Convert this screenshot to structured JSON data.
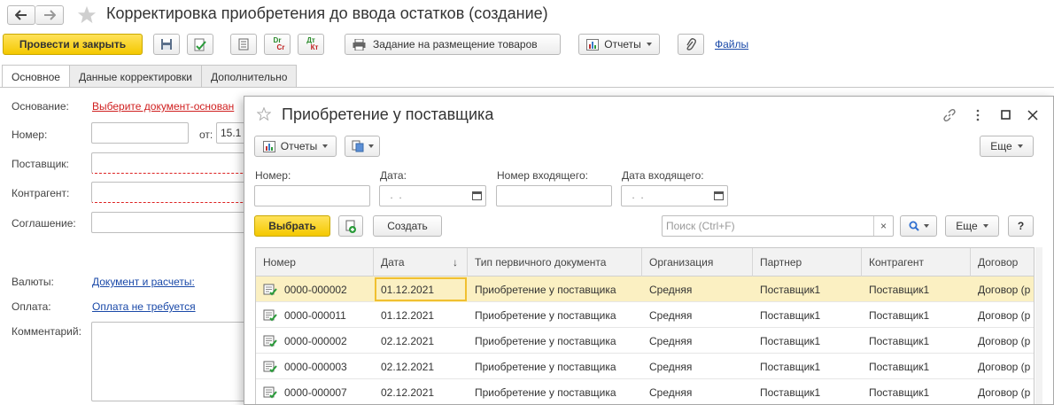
{
  "window": {
    "title": "Корректировка приобретения до ввода остатков (создание)"
  },
  "toolbar": {
    "post_close": "Провести и закрыть",
    "dr_top": "Dr",
    "dr_bottom": "Cr",
    "dt_top": "Дт",
    "dt_bottom": "Кт",
    "placement_task": "Задание на размещение товаров",
    "reports": "Отчеты",
    "files": "Файлы"
  },
  "tabs": [
    "Основное",
    "Данные корректировки",
    "Дополнительно"
  ],
  "form": {
    "basis_label": "Основание:",
    "basis_link": "Выберите документ-основан",
    "number_label": "Номер:",
    "from_label": "от:",
    "date_value": "15.1",
    "supplier_label": "Поставщик:",
    "counterparty_label": "Контрагент:",
    "agreement_label": "Соглашение:",
    "currency_label": "Валюты:",
    "currency_link": "Документ и расчеты:",
    "payment_label": "Оплата:",
    "payment_link": "Оплата не требуется",
    "comment_label": "Комментарий:"
  },
  "modal": {
    "title": "Приобретение у поставщика",
    "reports": "Отчеты",
    "more": "Еще",
    "filters": {
      "number_label": "Номер:",
      "date_label": "Дата:",
      "date_placeholder": " .  .",
      "incoming_number_label": "Номер входящего:",
      "incoming_date_label": "Дата входящего:"
    },
    "select": "Выбрать",
    "create": "Создать",
    "search_placeholder": "Поиск (Ctrl+F)",
    "help": "?",
    "columns": [
      "Номер",
      "Дата",
      "Тип первичного документа",
      "Организация",
      "Партнер",
      "Контрагент",
      "Договор"
    ],
    "sort_arrow": "↓",
    "rows": [
      [
        "0000-000002",
        "01.12.2021",
        "Приобретение у поставщика",
        "Средняя",
        "Поставщик1",
        "Поставщик1",
        "Договор (р"
      ],
      [
        "0000-000011",
        "01.12.2021",
        "Приобретение у поставщика",
        "Средняя",
        "Поставщик1",
        "Поставщик1",
        "Договор (р"
      ],
      [
        "0000-000002",
        "02.12.2021",
        "Приобретение у поставщика",
        "Средняя",
        "Поставщик1",
        "Поставщик1",
        "Договор (р"
      ],
      [
        "0000-000003",
        "02.12.2021",
        "Приобретение у поставщика",
        "Средняя",
        "Поставщик1",
        "Поставщик1",
        "Договор (р"
      ],
      [
        "0000-000007",
        "02.12.2021",
        "Приобретение у поставщика",
        "Средняя",
        "Поставщик1",
        "Поставщик1",
        "Договор (р"
      ]
    ]
  },
  "colors": {
    "accent_yellow": "#f4c800",
    "link_blue": "#1a49a8",
    "required_red": "#d22222",
    "selected_row": "#fbf0c2"
  }
}
